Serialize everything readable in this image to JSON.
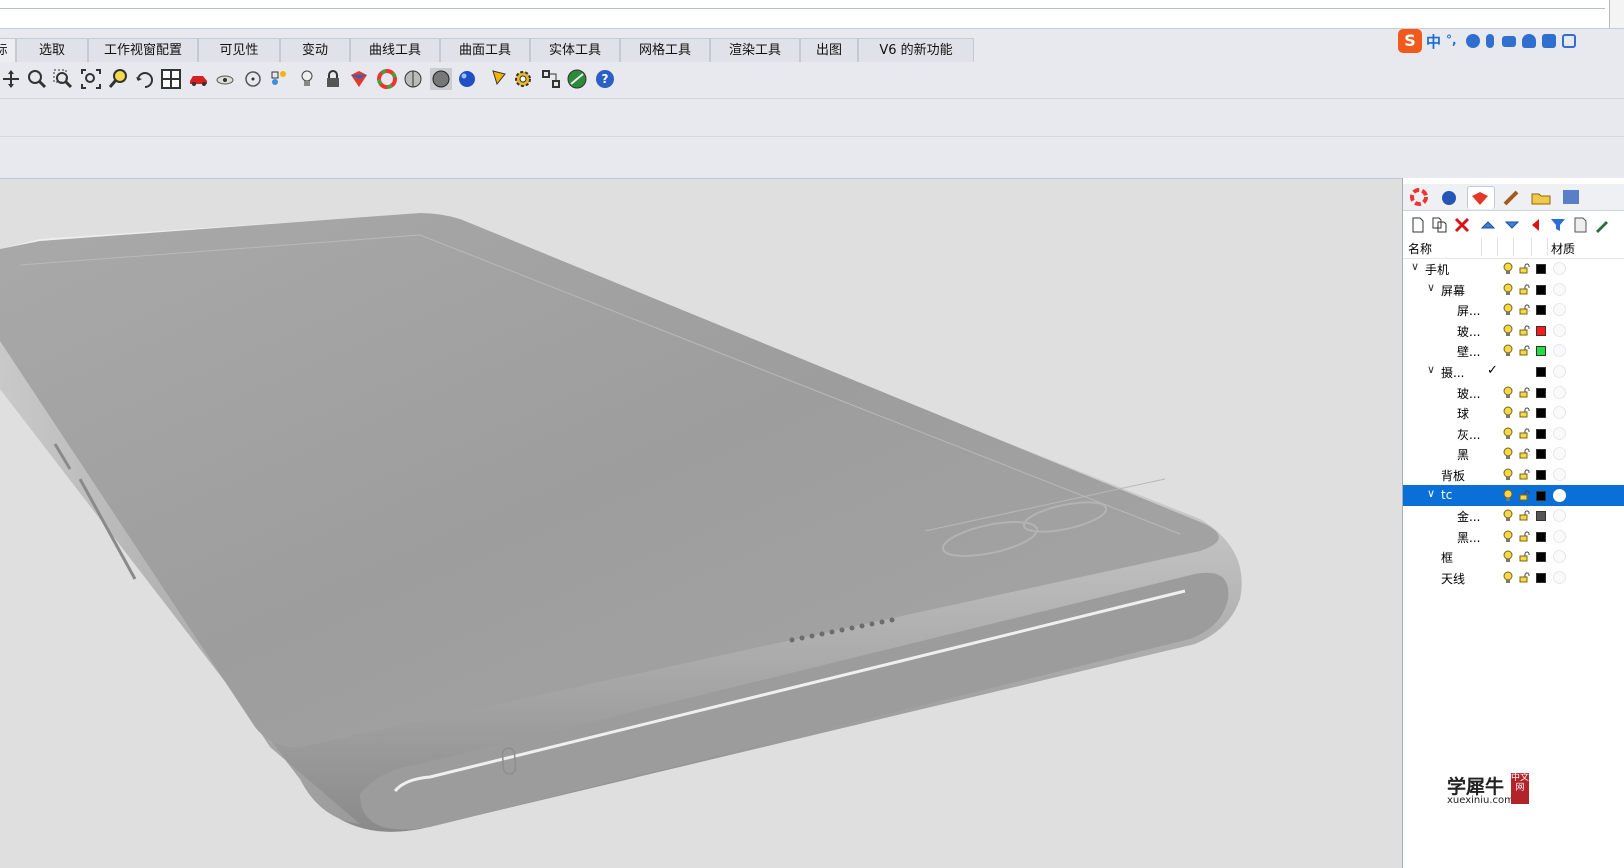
{
  "tabs": [
    {
      "label": "标"
    },
    {
      "label": "选取"
    },
    {
      "label": "工作视窗配置"
    },
    {
      "label": "可见性"
    },
    {
      "label": "变动"
    },
    {
      "label": "曲线工具"
    },
    {
      "label": "曲面工具"
    },
    {
      "label": "实体工具"
    },
    {
      "label": "网格工具"
    },
    {
      "label": "渲染工具"
    },
    {
      "label": "出图"
    },
    {
      "label": "V6 的新功能"
    }
  ],
  "ime": {
    "logo": "S",
    "lang": "中",
    "punct": "°,"
  },
  "toolbar_icons": [
    "pan-icon",
    "zoom-icon",
    "zoom-window-icon",
    "zoom-extents-icon",
    "zoom-selected-icon",
    "rotate-view-icon",
    "four-viewports-icon",
    "car-icon",
    "eye-icon",
    "target-icon",
    "color-dots-icon",
    "bulb-icon",
    "lock-icon",
    "material-book-icon",
    "color-wheel-icon",
    "shaded-sphere-icon",
    "rendered-sphere-icon",
    "blue-sphere-icon",
    "pencil-icon",
    "gear-icon",
    "grip-icon",
    "globe-icon",
    "help-icon"
  ],
  "layers_panel": {
    "header": {
      "name": "名称",
      "material": "材质"
    },
    "rows": [
      {
        "label": "手机",
        "level": 0,
        "expanded": true,
        "color": "#000000"
      },
      {
        "label": "屏幕",
        "level": 1,
        "expanded": true,
        "color": "#000000"
      },
      {
        "label": "屏...",
        "level": 2,
        "color": "#000000"
      },
      {
        "label": "玻...",
        "level": 2,
        "color": "#ff1a1a"
      },
      {
        "label": "壁...",
        "level": 2,
        "color": "#22dd44"
      },
      {
        "label": "摄...",
        "level": 1,
        "expanded": true,
        "color": "#000000",
        "current": true
      },
      {
        "label": "玻...",
        "level": 2,
        "color": "#000000"
      },
      {
        "label": "球",
        "level": 2,
        "color": "#000000"
      },
      {
        "label": "灰...",
        "level": 2,
        "color": "#000000"
      },
      {
        "label": "黑",
        "level": 2,
        "color": "#000000"
      },
      {
        "label": "背板",
        "level": 1,
        "color": "#000000"
      },
      {
        "label": "tc",
        "level": 1,
        "expanded": true,
        "color": "#000000",
        "selected": true
      },
      {
        "label": "金...",
        "level": 2,
        "color": "#555555"
      },
      {
        "label": "黑...",
        "level": 2,
        "color": "#000000"
      },
      {
        "label": "框",
        "level": 1,
        "color": "#000000"
      },
      {
        "label": "天线",
        "level": 1,
        "color": "#000000"
      }
    ]
  },
  "watermark": {
    "title": "学犀牛",
    "url": "xuexiniu.com",
    "stamp": "中文网"
  }
}
